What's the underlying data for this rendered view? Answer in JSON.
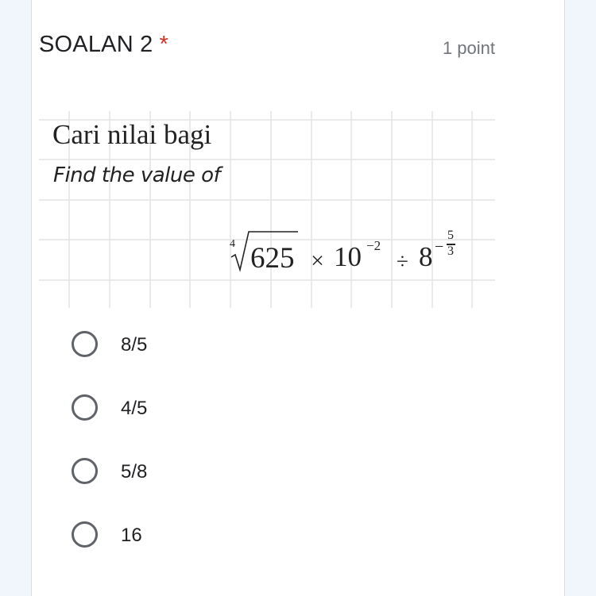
{
  "question": {
    "title": "SOALAN 2",
    "required_mark": "*",
    "points": "1 point",
    "image": {
      "text_bm": "Cari nilai bagi",
      "text_en": "Find the value of",
      "expression": {
        "root_index": "4",
        "radicand": "625",
        "times": "×",
        "base_ten": "10",
        "ten_exponent": "−2",
        "divide": "÷",
        "base_eight": "8",
        "eight_exponent_sign": "−",
        "eight_exponent_numerator": "5",
        "eight_exponent_denominator": "3"
      }
    },
    "options": [
      {
        "label": "8/5",
        "selected": false
      },
      {
        "label": "4/5",
        "selected": false
      },
      {
        "label": "5/8",
        "selected": false
      },
      {
        "label": "16",
        "selected": false
      }
    ]
  },
  "colors": {
    "required": "#d93025",
    "radio_border": "#5f6368",
    "page_background": "#f0f6fc",
    "grid": "#e4e4e4"
  }
}
